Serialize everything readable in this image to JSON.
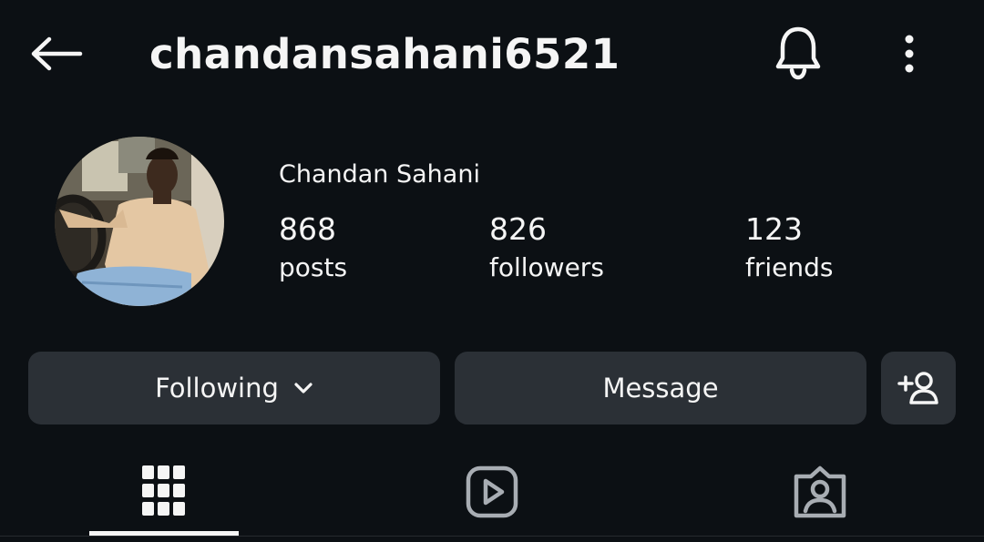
{
  "header": {
    "username": "chandansahani6521",
    "icons": [
      "back-arrow-icon",
      "bell-icon",
      "more-vertical-icon"
    ]
  },
  "profile": {
    "display_name": "Chandan Sahani",
    "stats": {
      "posts": {
        "value": "868",
        "label": "posts"
      },
      "followers": {
        "value": "826",
        "label": "followers"
      },
      "friends": {
        "value": "123",
        "label": "friends"
      }
    }
  },
  "actions": {
    "following_label": "Following",
    "message_label": "Message",
    "add_friend_icon": "add-person-icon"
  },
  "tabs": {
    "items": [
      "grid-icon",
      "reels-icon",
      "tagged-icon"
    ],
    "active_index": 0
  },
  "colors": {
    "background": "#0c1014",
    "button": "#2b3036",
    "text": "#f5f5f5",
    "icon_muted": "#a8adb3"
  }
}
